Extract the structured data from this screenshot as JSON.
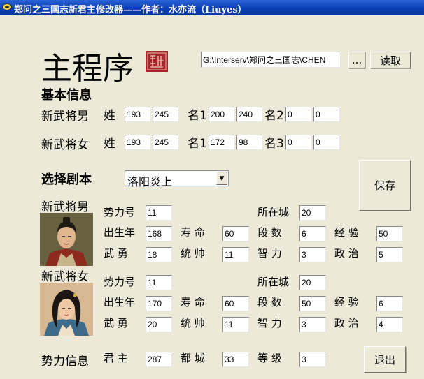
{
  "window": {
    "title": "郑问之三国志新君主修改器——作者：水亦流（Liuyes）"
  },
  "main_title": "主程序",
  "path": {
    "value": "G:\\Interserv\\郑问之三国志\\CHEN",
    "browse_label": "...",
    "read_label": "读取"
  },
  "basic": {
    "heading": "基本信息",
    "male": {
      "label": "新武将男",
      "surname_label": "姓",
      "surname": [
        "193",
        "245"
      ],
      "name1_label": "名1",
      "name1": [
        "200",
        "240"
      ],
      "name2_label": "名2",
      "name2": [
        "0",
        "0"
      ]
    },
    "female": {
      "label": "新武将女",
      "surname_label": "姓",
      "surname": [
        "193",
        "245"
      ],
      "name1_label": "名1",
      "name1": [
        "172",
        "98"
      ],
      "name3_label": "名3",
      "name3": [
        "0",
        "0"
      ]
    }
  },
  "scenario": {
    "label": "选择剧本",
    "selected": "洛阳炎上"
  },
  "save_label": "保存",
  "labels": {
    "faction": "势力号",
    "city": "所在城",
    "birth": "出生年",
    "life": "寿 命",
    "rank": "段 数",
    "exp": "经 验",
    "valor": "武 勇",
    "command": "统 帅",
    "intel": "智 力",
    "politics": "政 治"
  },
  "male_general": {
    "label": "新武将男",
    "faction": "11",
    "city": "20",
    "birth": "168",
    "life": "60",
    "rank": "6",
    "exp": "50",
    "valor": "18",
    "command": "11",
    "intel": "3",
    "politics": "5"
  },
  "female_general": {
    "label": "新武将女",
    "faction": "11",
    "city": "20",
    "birth": "170",
    "life": "60",
    "rank": "50",
    "exp": "6",
    "valor": "20",
    "command": "11",
    "intel": "3",
    "politics": "4"
  },
  "power": {
    "label": "势力信息",
    "lord_label": "君 主",
    "lord": "287",
    "capital_label": "都 城",
    "capital": "33",
    "level_label": "等 级",
    "level": "3"
  },
  "exit_label": "退出"
}
